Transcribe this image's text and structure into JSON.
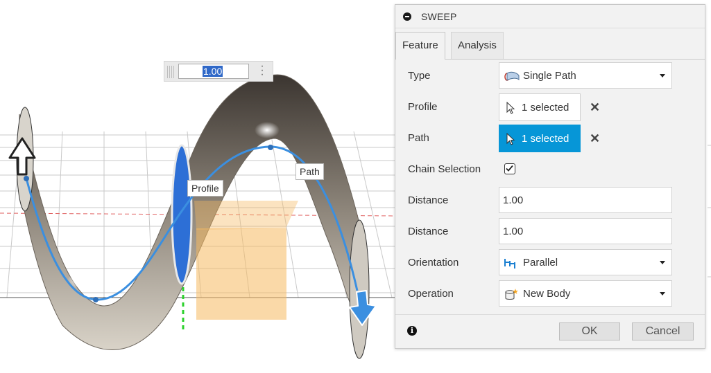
{
  "viewport": {
    "profile_label": "Profile",
    "path_label": "Path",
    "distance_input_value": "1.00"
  },
  "dialog": {
    "title": "SWEEP",
    "tabs": [
      {
        "label": "Feature",
        "active": true
      },
      {
        "label": "Analysis",
        "active": false
      }
    ],
    "fields": {
      "type": {
        "label": "Type",
        "value": "Single Path",
        "icon": "sweep-type-icon"
      },
      "profile": {
        "label": "Profile",
        "value": "1 selected",
        "icon": "cursor-arrow-icon"
      },
      "path": {
        "label": "Path",
        "value": "1 selected",
        "icon": "cursor-arrow-icon"
      },
      "chain_selection": {
        "label": "Chain Selection",
        "checked": true
      },
      "distance1": {
        "label": "Distance",
        "value": "1.00"
      },
      "distance2": {
        "label": "Distance",
        "value": "1.00"
      },
      "orientation": {
        "label": "Orientation",
        "value": "Parallel",
        "icon": "parallel-icon"
      },
      "operation": {
        "label": "Operation",
        "value": "New Body",
        "icon": "new-body-icon"
      }
    },
    "buttons": {
      "ok": "OK",
      "cancel": "Cancel"
    },
    "colors": {
      "selection_blue": "#0696d7",
      "profile_blue": "#2d6fd6",
      "path_blue": "#3b8fe0"
    }
  }
}
